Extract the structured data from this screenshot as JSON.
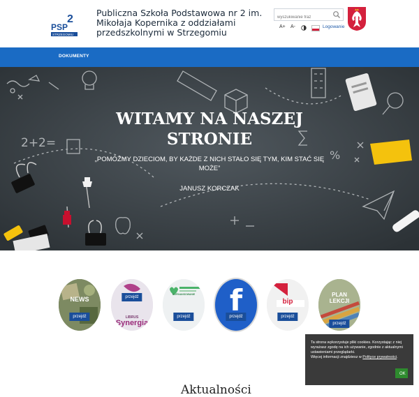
{
  "header": {
    "logo_text": "PSP",
    "logo_number": "2",
    "logo_sub": "STRZEGOMIU",
    "school_name": "Publiczna Szkoła Podstawowa nr 2 im. Mikołaja Kopernika z oddziałami przedszkolnymi w Strzegomiu",
    "search_placeholder": "wyszukiwanie fraz",
    "font_increase": "A+",
    "font_decrease": "A-",
    "login": "Logowanie"
  },
  "nav": {
    "items": [
      {
        "label": "DOKUMENTY"
      }
    ]
  },
  "hero": {
    "title": "WITAMY NA NASZEJ STRONIE",
    "quote": "„POMÓŻMY DZIECIOM, BY KAŻDE Z NICH STAŁO SIĘ TYM, KIM STAĆ SIĘ MOŻE”",
    "author": "JANUSZ KORCZAK",
    "board_text": "2+2="
  },
  "tiles": [
    {
      "label": "NEWS",
      "button": "przejdź"
    },
    {
      "label": "Synergia",
      "sublabel": "LIBRUS",
      "button": "przejdź"
    },
    {
      "label": "DOFINANSOWANIE",
      "button": "przejdź"
    },
    {
      "label": "f",
      "button": "przejdź"
    },
    {
      "label": "bip",
      "button": "przejdź"
    },
    {
      "label": "PLAN LEKCJI",
      "button": "przejdź"
    }
  ],
  "cookie": {
    "text": "Ta strona wykorzystuje pliki cookies. Korzystając z niej wyrażasz zgodę na ich używanie, zgodnie z aktualnymi ustawieniami przeglądarki.",
    "more_text": "Więcej informacji znajdziesz w",
    "policy_link": "Polityce prywatności",
    "ok": "OK"
  },
  "news_heading": "Aktualności",
  "colors": {
    "nav": "#1a6bc4",
    "button": "#1a4e9a",
    "cookie_bg": "#3a3a3a",
    "cookie_ok": "#2e8b2e"
  }
}
